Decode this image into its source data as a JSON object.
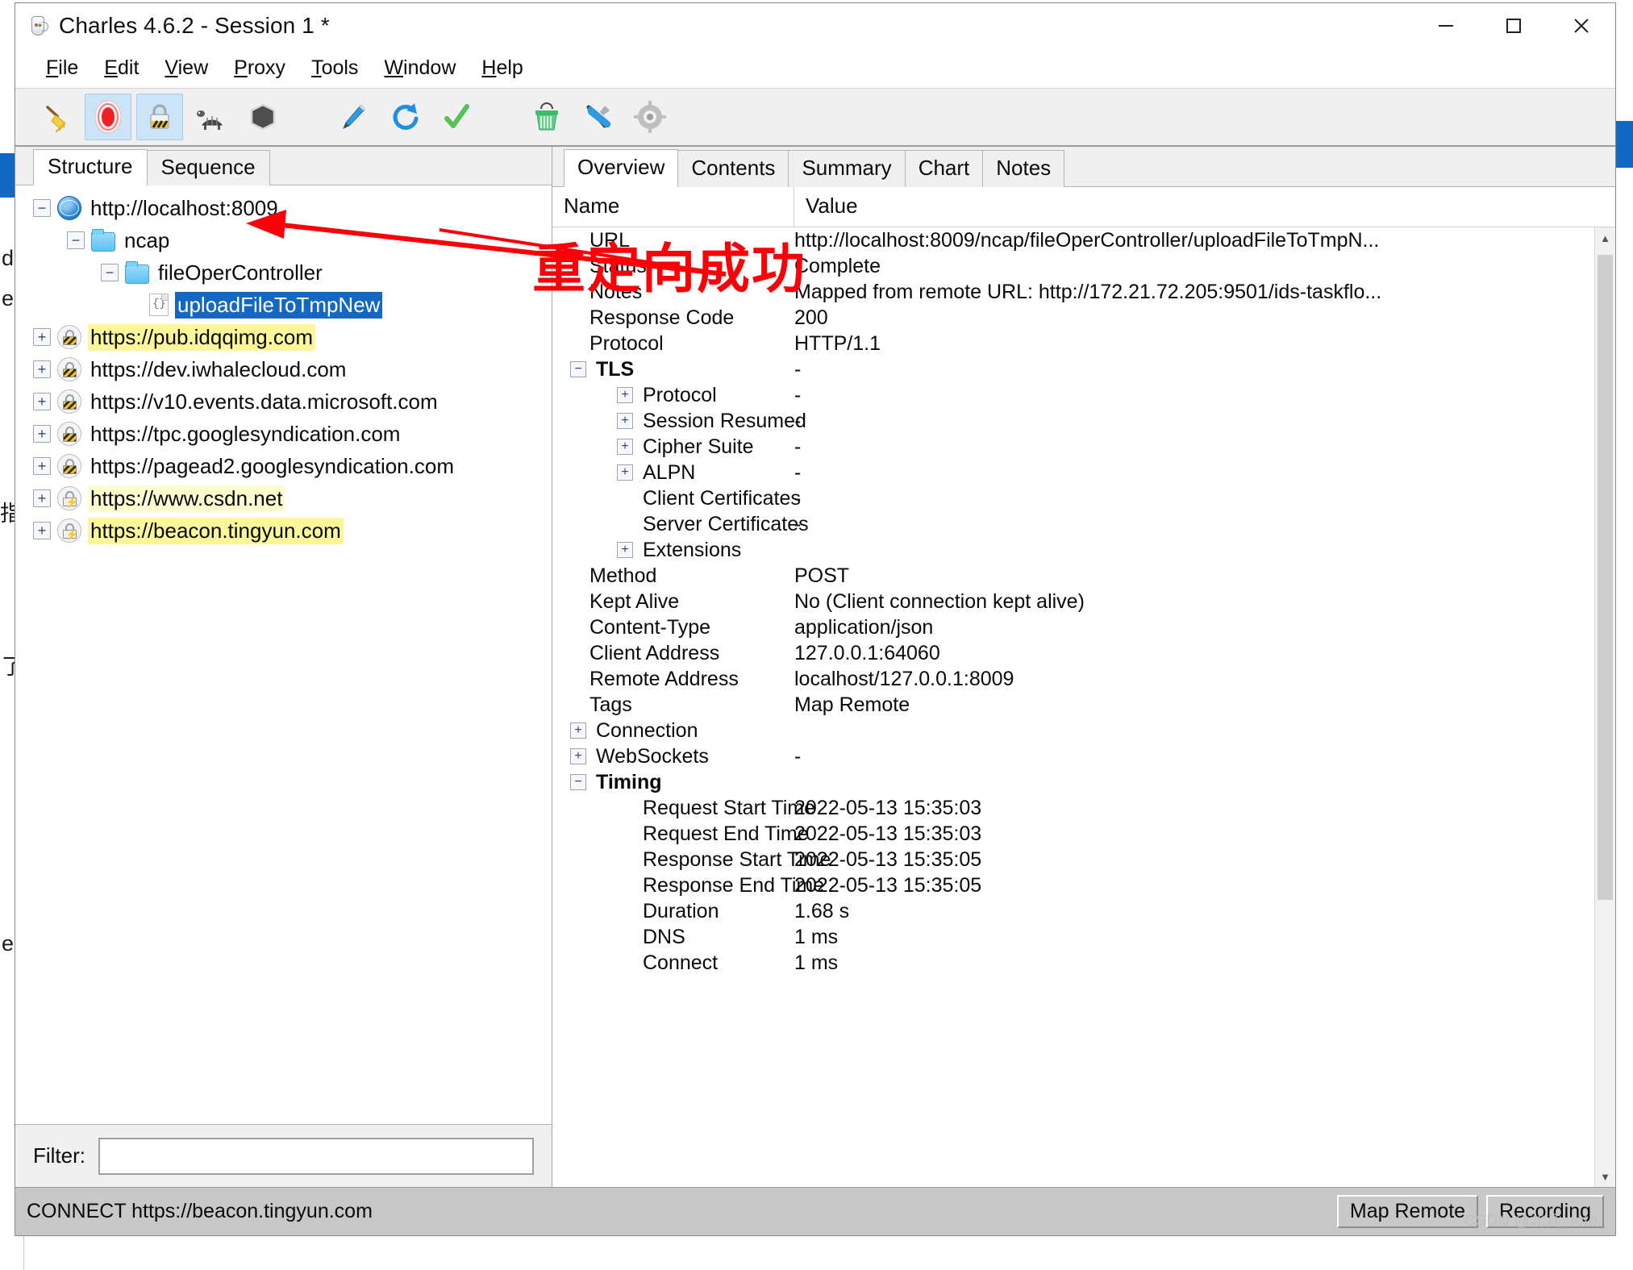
{
  "window": {
    "title": "Charles 4.6.2 - Session 1 *",
    "app_icon": "charles-jug-icon",
    "controls": {
      "minimize": "minimize-icon",
      "maximize": "maximize-icon",
      "close": "close-icon"
    }
  },
  "menubar": {
    "items": [
      {
        "label": "File",
        "mnemonic": "F"
      },
      {
        "label": "Edit",
        "mnemonic": "E"
      },
      {
        "label": "View",
        "mnemonic": "V"
      },
      {
        "label": "Proxy",
        "mnemonic": "P"
      },
      {
        "label": "Tools",
        "mnemonic": "T"
      },
      {
        "label": "Window",
        "mnemonic": "W"
      },
      {
        "label": "Help",
        "mnemonic": "H"
      }
    ]
  },
  "toolbar": {
    "buttons": [
      {
        "icon": "broom-clear-icon",
        "active": false
      },
      {
        "icon": "record-stop-icon",
        "active": true
      },
      {
        "icon": "ssl-proxying-lock-icon",
        "active": true
      },
      {
        "icon": "throttle-turtle-icon",
        "active": false
      },
      {
        "icon": "breakpoints-hexagon-icon",
        "active": false
      },
      {
        "icon": "compose-pen-icon",
        "active": false
      },
      {
        "icon": "repeat-refresh-icon",
        "active": false
      },
      {
        "icon": "validate-check-icon",
        "active": false
      },
      {
        "icon": "trash-basket-icon",
        "active": false
      },
      {
        "icon": "tools-wrench-icon",
        "active": false
      },
      {
        "icon": "settings-gear-icon",
        "active": false
      }
    ]
  },
  "left_pane": {
    "tabs": [
      {
        "label": "Structure",
        "selected": true
      },
      {
        "label": "Sequence",
        "selected": false
      }
    ],
    "tree": [
      {
        "label": "http://localhost:8009",
        "indent": 0,
        "toggle": "-",
        "icon": "globe-icon",
        "state": "normal"
      },
      {
        "label": "ncap",
        "indent": 1,
        "toggle": "-",
        "icon": "folder-icon",
        "state": "normal"
      },
      {
        "label": "fileOperController",
        "indent": 2,
        "toggle": "-",
        "icon": "folder-icon",
        "state": "normal"
      },
      {
        "label": "uploadFileToTmpNew",
        "indent": 3,
        "toggle": "",
        "icon": "json-file-icon",
        "state": "selected"
      },
      {
        "label": "https://pub.idqqimg.com",
        "indent": 0,
        "toggle": "+",
        "icon": "lock-icon",
        "state": "highlight"
      },
      {
        "label": "https://dev.iwhalecloud.com",
        "indent": 0,
        "toggle": "+",
        "icon": "lock-icon",
        "state": "normal"
      },
      {
        "label": "https://v10.events.data.microsoft.com",
        "indent": 0,
        "toggle": "+",
        "icon": "lock-icon",
        "state": "normal"
      },
      {
        "label": "https://tpc.googlesyndication.com",
        "indent": 0,
        "toggle": "+",
        "icon": "lock-icon",
        "state": "normal"
      },
      {
        "label": "https://pagead2.googlesyndication.com",
        "indent": 0,
        "toggle": "+",
        "icon": "lock-icon",
        "state": "normal"
      },
      {
        "label": "https://www.csdn.net",
        "indent": 0,
        "toggle": "+",
        "icon": "lock-bolt-icon",
        "state": "highlight-soft"
      },
      {
        "label": "https://beacon.tingyun.com",
        "indent": 0,
        "toggle": "+",
        "icon": "lock-bolt-icon",
        "state": "highlight"
      }
    ],
    "filter": {
      "label": "Filter:",
      "value": "",
      "placeholder": ""
    }
  },
  "right_pane": {
    "tabs": [
      {
        "label": "Overview",
        "selected": true
      },
      {
        "label": "Contents",
        "selected": false
      },
      {
        "label": "Summary",
        "selected": false
      },
      {
        "label": "Chart",
        "selected": false
      },
      {
        "label": "Notes",
        "selected": false
      }
    ],
    "columns": {
      "name": "Name",
      "value": "Value"
    },
    "rows": [
      {
        "name": "URL",
        "value": "http://localhost:8009/ncap/fileOperController/uploadFileToTmpN...",
        "indent": 1,
        "toggle": "",
        "bold": false
      },
      {
        "name": "Status",
        "value": "Complete",
        "indent": 1,
        "toggle": "",
        "bold": false
      },
      {
        "name": "Notes",
        "value": "Mapped from remote URL: http://172.21.72.205:9501/ids-taskflo...",
        "indent": 1,
        "toggle": "",
        "bold": false
      },
      {
        "name": "Response Code",
        "value": "200",
        "indent": 1,
        "toggle": "",
        "bold": false
      },
      {
        "name": "Protocol",
        "value": "HTTP/1.1",
        "indent": 1,
        "toggle": "",
        "bold": false
      },
      {
        "name": "TLS",
        "value": "-",
        "indent": 0,
        "toggle": "-",
        "bold": true
      },
      {
        "name": "Protocol",
        "value": "-",
        "indent": 2,
        "toggle": "+",
        "bold": false
      },
      {
        "name": "Session Resumed",
        "value": "-",
        "indent": 2,
        "toggle": "+",
        "bold": false
      },
      {
        "name": "Cipher Suite",
        "value": "-",
        "indent": 2,
        "toggle": "+",
        "bold": false
      },
      {
        "name": "ALPN",
        "value": "-",
        "indent": 2,
        "toggle": "+",
        "bold": false
      },
      {
        "name": "Client Certificates",
        "value": "-",
        "indent": 2,
        "toggle": "",
        "bold": false
      },
      {
        "name": "Server Certificates",
        "value": "-",
        "indent": 2,
        "toggle": "",
        "bold": false
      },
      {
        "name": "Extensions",
        "value": "",
        "indent": 2,
        "toggle": "+",
        "bold": false
      },
      {
        "name": "Method",
        "value": "POST",
        "indent": 1,
        "toggle": "",
        "bold": false
      },
      {
        "name": "Kept Alive",
        "value": "No (Client connection kept alive)",
        "indent": 1,
        "toggle": "",
        "bold": false
      },
      {
        "name": "Content-Type",
        "value": "application/json",
        "indent": 1,
        "toggle": "",
        "bold": false
      },
      {
        "name": "Client Address",
        "value": "127.0.0.1:64060",
        "indent": 1,
        "toggle": "",
        "bold": false
      },
      {
        "name": "Remote Address",
        "value": "localhost/127.0.0.1:8009",
        "indent": 1,
        "toggle": "",
        "bold": false
      },
      {
        "name": "Tags",
        "value": "Map Remote",
        "indent": 1,
        "toggle": "",
        "bold": false
      },
      {
        "name": "Connection",
        "value": "",
        "indent": 0,
        "toggle": "+",
        "bold": false
      },
      {
        "name": "WebSockets",
        "value": "-",
        "indent": 0,
        "toggle": "+",
        "bold": false
      },
      {
        "name": "Timing",
        "value": "",
        "indent": 0,
        "toggle": "-",
        "bold": true
      },
      {
        "name": "Request Start Time",
        "value": "2022-05-13 15:35:03",
        "indent": 2,
        "toggle": "",
        "bold": false
      },
      {
        "name": "Request End Time",
        "value": "2022-05-13 15:35:03",
        "indent": 2,
        "toggle": "",
        "bold": false
      },
      {
        "name": "Response Start Time",
        "value": "2022-05-13 15:35:05",
        "indent": 2,
        "toggle": "",
        "bold": false
      },
      {
        "name": "Response End Time",
        "value": "2022-05-13 15:35:05",
        "indent": 2,
        "toggle": "",
        "bold": false
      },
      {
        "name": "Duration",
        "value": "1.68 s",
        "indent": 2,
        "toggle": "",
        "bold": false
      },
      {
        "name": "DNS",
        "value": "1 ms",
        "indent": 2,
        "toggle": "",
        "bold": false
      },
      {
        "name": "Connect",
        "value": "1 ms",
        "indent": 2,
        "toggle": "",
        "bold": false
      }
    ]
  },
  "statusbar": {
    "text": "CONNECT https://beacon.tingyun.com",
    "buttons": [
      {
        "label": "Map Remote"
      },
      {
        "label": "Recording"
      }
    ]
  },
  "annotation": {
    "text": "重定向成功",
    "color": "#fb0007",
    "arrow": "red-arrow-pointing-to-localhost-node"
  },
  "watermark": "CSDN @北几_toto",
  "colors": {
    "selection_blue": "#1268c3",
    "highlight_yellow": "#fbf79a",
    "annotation_red": "#fb0007",
    "toolbar_active": "#cce4f7",
    "statusbar_gray": "#c8c8c8"
  }
}
